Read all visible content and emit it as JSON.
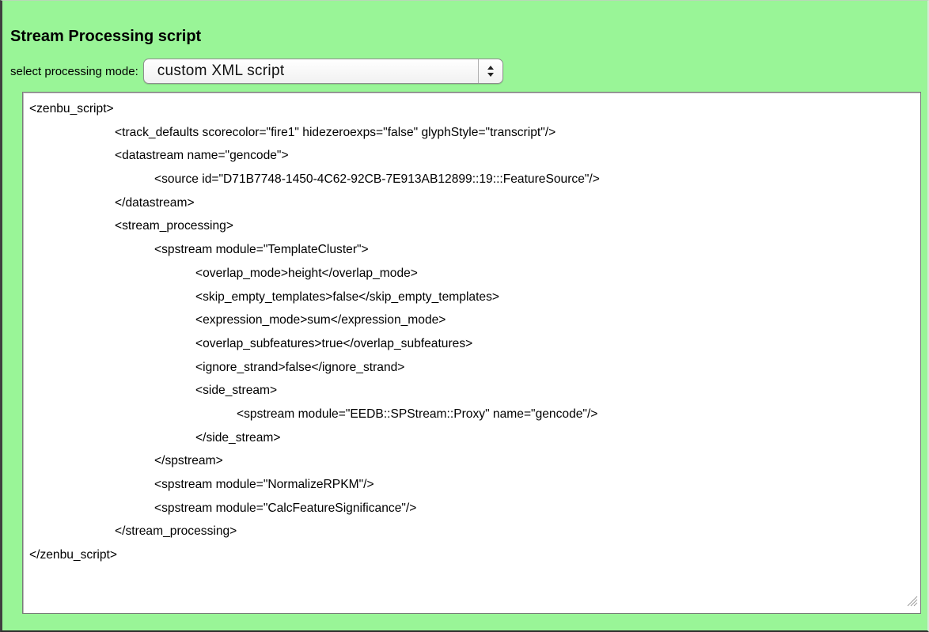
{
  "panel": {
    "title": "Stream Processing script",
    "mode_label": "select processing mode:",
    "mode_selected": "custom XML script"
  },
  "script": {
    "lines": [
      {
        "indent": 0,
        "text": "<zenbu_script>"
      },
      {
        "indent": 1,
        "text": "<track_defaults scorecolor=\"fire1\" hidezeroexps=\"false\" glyphStyle=\"transcript\"/>"
      },
      {
        "indent": 1,
        "text": "<datastream name=\"gencode\">"
      },
      {
        "indent": 2,
        "text": "<source id=\"D71B7748-1450-4C62-92CB-7E913AB12899::19:::FeatureSource\"/>"
      },
      {
        "indent": 1,
        "text": "</datastream>"
      },
      {
        "indent": 1,
        "text": "<stream_processing>"
      },
      {
        "indent": 2,
        "text": "<spstream module=\"TemplateCluster\">"
      },
      {
        "indent": 3,
        "text": "<overlap_mode>height</overlap_mode>"
      },
      {
        "indent": 3,
        "text": "<skip_empty_templates>false</skip_empty_templates>"
      },
      {
        "indent": 3,
        "text": "<expression_mode>sum</expression_mode>"
      },
      {
        "indent": 3,
        "text": "<overlap_subfeatures>true</overlap_subfeatures>"
      },
      {
        "indent": 3,
        "text": "<ignore_strand>false</ignore_strand>"
      },
      {
        "indent": 3,
        "text": "<side_stream>"
      },
      {
        "indent": 4,
        "text": "<spstream module=\"EEDB::SPStream::Proxy\" name=\"gencode\"/>"
      },
      {
        "indent": 3,
        "text": "</side_stream>"
      },
      {
        "indent": 2,
        "text": "</spstream>"
      },
      {
        "indent": 2,
        "text": "<spstream module=\"NormalizeRPKM\"/>"
      },
      {
        "indent": 2,
        "text": "<spstream module=\"CalcFeatureSignificance\"/>"
      },
      {
        "indent": 1,
        "text": "</stream_processing>"
      },
      {
        "indent": 0,
        "text": "</zenbu_script>"
      }
    ]
  },
  "icons": {
    "select_arrows": "up-down-chevron-icon",
    "resize_handle": "resize-grip-icon"
  },
  "colors": {
    "panel_background": "#99f597",
    "editor_background": "#ffffff"
  }
}
